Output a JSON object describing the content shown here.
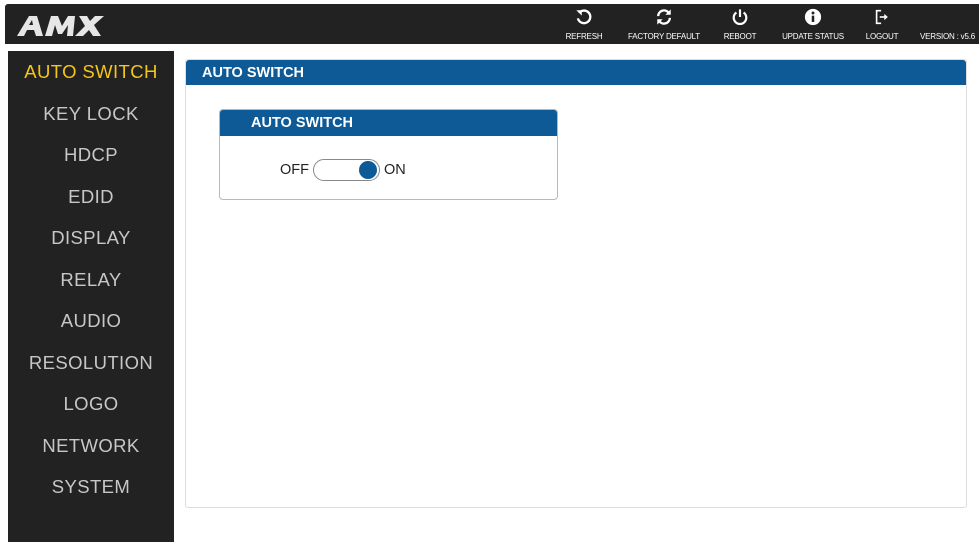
{
  "header": {
    "logo_text": "AMX",
    "buttons": [
      {
        "label": "REFRESH",
        "icon": "refresh-icon"
      },
      {
        "label": "FACTORY DEFAULT",
        "icon": "sync-icon"
      },
      {
        "label": "REBOOT",
        "icon": "power-icon"
      },
      {
        "label": "UPDATE STATUS",
        "icon": "info-icon"
      },
      {
        "label": "LOGOUT",
        "icon": "logout-icon"
      }
    ],
    "version": "VERSION : v5.6"
  },
  "sidebar": {
    "items": [
      {
        "label": "AUTO SWITCH",
        "active": true
      },
      {
        "label": "KEY LOCK"
      },
      {
        "label": "HDCP"
      },
      {
        "label": "EDID"
      },
      {
        "label": "DISPLAY"
      },
      {
        "label": "RELAY"
      },
      {
        "label": "AUDIO"
      },
      {
        "label": "RESOLUTION"
      },
      {
        "label": "LOGO"
      },
      {
        "label": "NETWORK"
      },
      {
        "label": "SYSTEM"
      }
    ]
  },
  "main": {
    "title": "AUTO SWITCH",
    "card": {
      "title": "AUTO SWITCH",
      "off_label": "OFF",
      "on_label": "ON",
      "state": "ON"
    }
  },
  "colors": {
    "header_bg": "#222222",
    "accent_blue": "#0e5a96",
    "active_nav": "#f5c518",
    "nav_text": "#c7c7c7"
  }
}
